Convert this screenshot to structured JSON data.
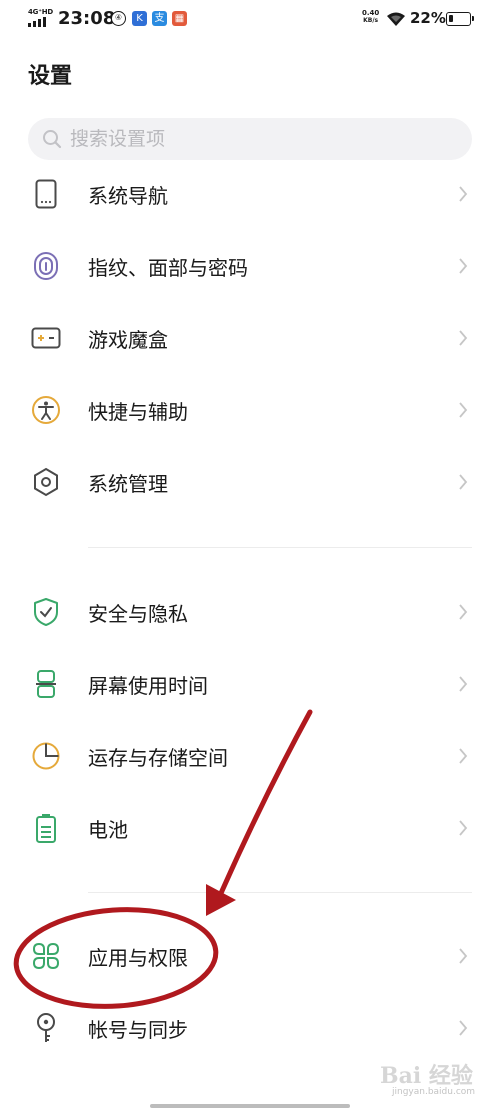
{
  "status_bar": {
    "network": "4G⁺HD",
    "time": "23:08",
    "net_speed_value": "0.40",
    "net_speed_unit": "KB/s",
    "battery_text": "22%",
    "battery_level": 0.22
  },
  "page": {
    "title": "设置"
  },
  "search": {
    "placeholder": "搜索设置项"
  },
  "items": [
    {
      "label": "系统导航",
      "icon": "phone-navigation-icon"
    },
    {
      "label": "指纹、面部与密码",
      "icon": "fingerprint-icon"
    },
    {
      "label": "游戏魔盒",
      "icon": "game-box-icon"
    },
    {
      "label": "快捷与辅助",
      "icon": "accessibility-icon"
    },
    {
      "label": "系统管理",
      "icon": "system-hexagon-icon"
    },
    {
      "label": "安全与隐私",
      "icon": "shield-check-icon"
    },
    {
      "label": "屏幕使用时间",
      "icon": "hourglass-icon"
    },
    {
      "label": "运存与存储空间",
      "icon": "storage-pie-icon"
    },
    {
      "label": "电池",
      "icon": "battery-icon"
    },
    {
      "label": "应用与权限",
      "icon": "apps-grid-icon"
    },
    {
      "label": "帐号与同步",
      "icon": "account-key-icon"
    }
  ],
  "watermark": {
    "text": "Bai 经验",
    "sub": "jingyan.baidu.com"
  },
  "colors": {
    "icon_gray": "#4a4a4a",
    "icon_purple": "#7b6fb5",
    "icon_yellow": "#e5a93a",
    "icon_green": "#3aa86a",
    "annotation_red": "#b0191e"
  }
}
